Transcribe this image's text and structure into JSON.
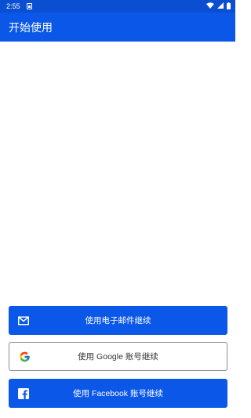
{
  "status_bar": {
    "time": "2:55",
    "icons": [
      "notification-icon",
      "wifi-icon",
      "signal-icon",
      "battery-icon"
    ]
  },
  "app_bar": {
    "title": "开始使用"
  },
  "buttons": {
    "email": {
      "label": "使用电子邮件继续",
      "icon": "envelope-icon"
    },
    "google": {
      "label": "使用 Google 账号继续",
      "icon": "google-icon"
    },
    "facebook": {
      "label": "使用 Facebook 账号继续",
      "icon": "facebook-icon"
    }
  },
  "colors": {
    "primary": "#0a57e8",
    "status_bar": "#0a4fd1",
    "google_border": "#8c8c8c"
  }
}
